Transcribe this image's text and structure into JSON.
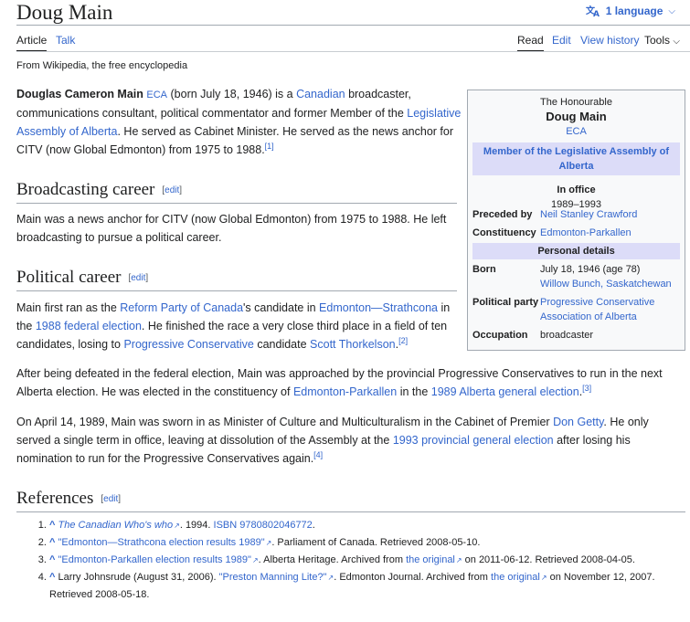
{
  "page": {
    "title": "Doug Main",
    "language_button": "1 language",
    "tabs": {
      "article": "Article",
      "talk": "Talk",
      "read": "Read",
      "edit": "Edit",
      "view_history": "View history",
      "tools": "Tools"
    },
    "tagline": "From Wikipedia, the free encyclopedia"
  },
  "intro": {
    "name": "Douglas Cameron Main",
    "eca": "ECA",
    "t1": " (born July 18, 1946) is a ",
    "canadian": "Canadian",
    "t2": " broadcaster, communications consultant, political commentator and former Member of the ",
    "legislative": "Legislative Assembly of Alberta",
    "t3": ". He served as Cabinet Minister. He served as the news anchor for CITV (now Global Edmonton) from 1975 to 1988.",
    "ref1": "[1]"
  },
  "broadcasting": {
    "heading": "Broadcasting career",
    "edit_open": "[",
    "edit": "edit",
    "edit_close": "]",
    "text": "Main was a news anchor for CITV (now Global Edmonton) from 1975 to 1988. He left broadcasting to pursue a political career."
  },
  "political": {
    "heading": "Political career",
    "edit": "edit",
    "p1": {
      "t1": "Main first ran as the ",
      "reform": "Reform Party of Canada",
      "t2": "'s candidate in ",
      "edm_strath": "Edmonton—Strathcona",
      "t3": " in the ",
      "fed1988": "1988 federal election",
      "t4": ". He finished the race a very close third place in a field of ten candidates, losing to ",
      "pc": "Progressive Conservative",
      "t5": " candidate ",
      "scott": "Scott Thorkelson",
      "t6": ".",
      "ref2": "[2]"
    },
    "p2": {
      "t1": "After being defeated in the federal election, Main was approached by the provincial Progressive Conservatives to run in the next Alberta election. He was elected in the constituency of ",
      "edm_park": "Edmonton-Parkallen",
      "t2": " in the ",
      "ab1989": "1989 Alberta general election",
      "t3": ".",
      "ref3": "[3]"
    },
    "p3": {
      "t1": "On April 14, 1989, Main was sworn in as Minister of Culture and Multiculturalism in the Cabinet of Premier ",
      "getty": "Don Getty",
      "t2": ". He only served a single term in office, leaving at dissolution of the Assembly at the ",
      "prov1993": "1993 provincial general election",
      "t3": " after losing his nomination to run for the Progressive Conservatives again.",
      "ref4": "[4]"
    }
  },
  "infobox": {
    "honorific": "The Honourable",
    "name": "Doug Main",
    "post_nominal": "ECA",
    "office": "Member of the Legislative Assembly of Alberta",
    "in_office_label": "In office",
    "in_office_years": "1989–1993",
    "preceded_label": "Preceded by",
    "preceded_value": "Neil Stanley Crawford",
    "constituency_label": "Constituency",
    "constituency_value": "Edmonton-Parkallen",
    "personal_details": "Personal details",
    "born_label": "Born",
    "born_date": "July 18, 1946 (age 78)",
    "born_place": "Willow Bunch, Saskatchewan",
    "party_label": "Political party",
    "party_value": "Progressive Conservative Association of Alberta",
    "occupation_label": "Occupation",
    "occupation_value": "broadcaster"
  },
  "references": {
    "heading": "References",
    "edit": "edit",
    "items": [
      {
        "caret": "^",
        "link": "The Canadian Who's who",
        "t1": ". 1994. ",
        "isbn": "ISBN 9780802046772",
        "t2": "."
      },
      {
        "caret": "^",
        "link": "\"Edmonton—Strathcona election results 1989\"",
        "t1": ". Parliament of Canada. Retrieved 2008-05-10."
      },
      {
        "caret": "^",
        "link": "\"Edmonton-Parkallen election results 1989\"",
        "t1": ". Alberta Heritage. Archived from ",
        "orig": "the original",
        "t2": " on 2011-06-12. Retrieved 2008-04-05."
      },
      {
        "caret": "^",
        "pre": "Larry Johnsrude (August 31, 2006). ",
        "link": "\"Preston Manning Lite?\"",
        "t1": ". Edmonton Journal. Archived from ",
        "orig": "the original",
        "t2": " on November 12, 2007. Retrieved 2008-05-18."
      }
    ]
  },
  "icons": {
    "language": "translate-icon",
    "chevron": "chevron-down-icon",
    "external": "external-link-icon"
  }
}
